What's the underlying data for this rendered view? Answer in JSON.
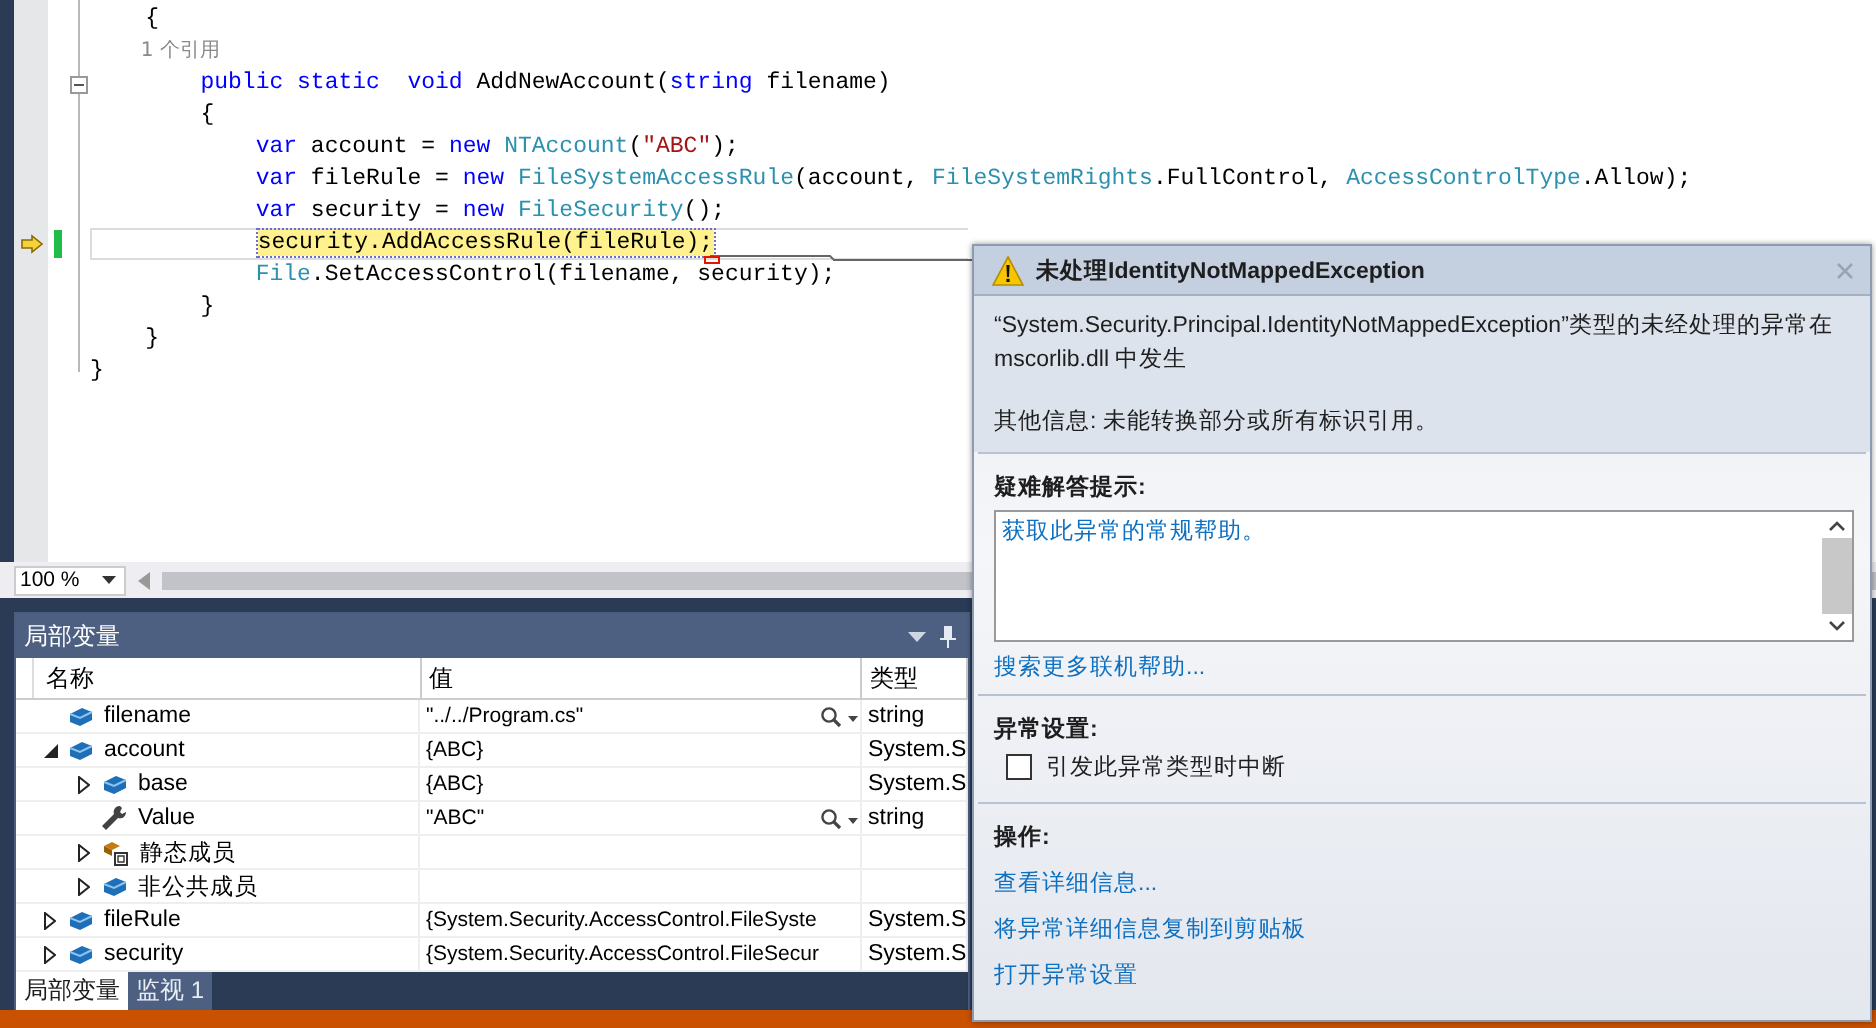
{
  "editor": {
    "lines": [
      {
        "kind": "code",
        "tokens": [
          {
            "text": "    {",
            "kind": "plain"
          }
        ]
      },
      {
        "kind": "lens",
        "tokens": [
          {
            "text": "        1 个引用",
            "kind": "lens"
          }
        ]
      },
      {
        "kind": "fold",
        "tokens": [
          {
            "text": "        public static ",
            "kind": "kw"
          },
          {
            "text": " void ",
            "kind": "kw"
          },
          {
            "text": "AddNewAccount(",
            "kind": "plain"
          },
          {
            "text": "string",
            "kind": "kw"
          },
          {
            "text": " filename)",
            "kind": "plain"
          }
        ]
      },
      {
        "kind": "code",
        "tokens": [
          {
            "text": "        {",
            "kind": "plain"
          }
        ]
      },
      {
        "kind": "code",
        "tokens": [
          {
            "text": "            var",
            "kind": "kw"
          },
          {
            "text": " account = ",
            "kind": "plain"
          },
          {
            "text": "new",
            "kind": "kw"
          },
          {
            "text": " NTAccount",
            "kind": "type"
          },
          {
            "text": "(",
            "kind": "plain"
          },
          {
            "text": "\"ABC\"",
            "kind": "str"
          },
          {
            "text": ");",
            "kind": "plain"
          }
        ]
      },
      {
        "kind": "code",
        "tokens": [
          {
            "text": "            var",
            "kind": "kw"
          },
          {
            "text": " fileRule = ",
            "kind": "plain"
          },
          {
            "text": "new",
            "kind": "kw"
          },
          {
            "text": " FileSystemAccessRule",
            "kind": "type"
          },
          {
            "text": "(account, ",
            "kind": "plain"
          },
          {
            "text": "FileSystemRights",
            "kind": "type"
          },
          {
            "text": ".FullControl, ",
            "kind": "plain"
          },
          {
            "text": "AccessControlType",
            "kind": "type"
          },
          {
            "text": ".Allow);",
            "kind": "plain"
          }
        ]
      },
      {
        "kind": "code",
        "tokens": [
          {
            "text": "            var",
            "kind": "kw"
          },
          {
            "text": " security = ",
            "kind": "plain"
          },
          {
            "text": "new",
            "kind": "kw"
          },
          {
            "text": " FileSecurity",
            "kind": "type"
          },
          {
            "text": "();",
            "kind": "plain"
          }
        ]
      },
      {
        "kind": "current",
        "tokens": [
          {
            "text": "            security.AddAccessRule(fileRule);",
            "kind": "hl"
          }
        ]
      },
      {
        "kind": "code",
        "tokens": [
          {
            "text": "            File",
            "kind": "type"
          },
          {
            "text": ".SetAccessControl(filename, security);",
            "kind": "plain"
          }
        ]
      },
      {
        "kind": "code",
        "tokens": [
          {
            "text": "        }",
            "kind": "plain"
          }
        ]
      },
      {
        "kind": "code",
        "tokens": [
          {
            "text": "    }",
            "kind": "plain"
          }
        ]
      },
      {
        "kind": "code",
        "tokens": [
          {
            "text": "}",
            "kind": "plain"
          }
        ]
      }
    ],
    "zoom": "100 %"
  },
  "locals": {
    "title": "局部变量",
    "columns": [
      "名称",
      "值",
      "类型"
    ],
    "rows": [
      {
        "name": "filename",
        "value": "\"../../Program.cs\"",
        "type": "string",
        "kind": "field",
        "expandable": false,
        "visualizer": true
      },
      {
        "name": "account",
        "value": "{ABC}",
        "type": "System.S",
        "kind": "field",
        "expandable": true,
        "expanded": true,
        "visualizer": false,
        "children": [
          {
            "name": "base",
            "value": "{ABC}",
            "type": "System.S",
            "kind": "field",
            "expandable": true,
            "expanded": false,
            "visualizer": false
          },
          {
            "name": "Value",
            "value": "\"ABC\"",
            "type": "string",
            "kind": "property",
            "expandable": false,
            "visualizer": true
          },
          {
            "name": "静态成员",
            "kind": "static",
            "expandable": true,
            "expanded": false,
            "visualizer": false
          },
          {
            "name": "非公共成员",
            "kind": "field",
            "expandable": true,
            "expanded": false,
            "visualizer": false
          }
        ]
      },
      {
        "name": "fileRule",
        "value": "{System.Security.AccessControl.FileSyste",
        "type": "System.S",
        "kind": "field",
        "expandable": true,
        "expanded": false,
        "visualizer": false
      },
      {
        "name": "security",
        "value": "{System.Security.AccessControl.FileSecur",
        "type": "System.S",
        "kind": "field",
        "expandable": true,
        "expanded": false,
        "visualizer": false
      }
    ],
    "tabs": [
      {
        "label": "局部变量",
        "selected": true
      },
      {
        "label": "监视 1",
        "selected": false
      }
    ]
  },
  "exception": {
    "title": "未处理IdentityNotMappedException",
    "message": "“System.Security.Principal.IdentityNotMappedException”类型的未经处理的异常在 mscorlib.dll 中发生",
    "additional": "其他信息: 未能转换部分或所有标识引用。",
    "tips_heading": "疑难解答提示:",
    "tips": [
      "获取此异常的常规帮助。"
    ],
    "search_link": "搜索更多联机帮助...",
    "settings_heading": "异常设置:",
    "break_option": {
      "label": "引发此异常类型时中断",
      "checked": false
    },
    "actions_heading": "操作:",
    "actions": [
      "查看详细信息...",
      "将异常详细信息复制到剪贴板",
      "打开异常设置"
    ]
  }
}
